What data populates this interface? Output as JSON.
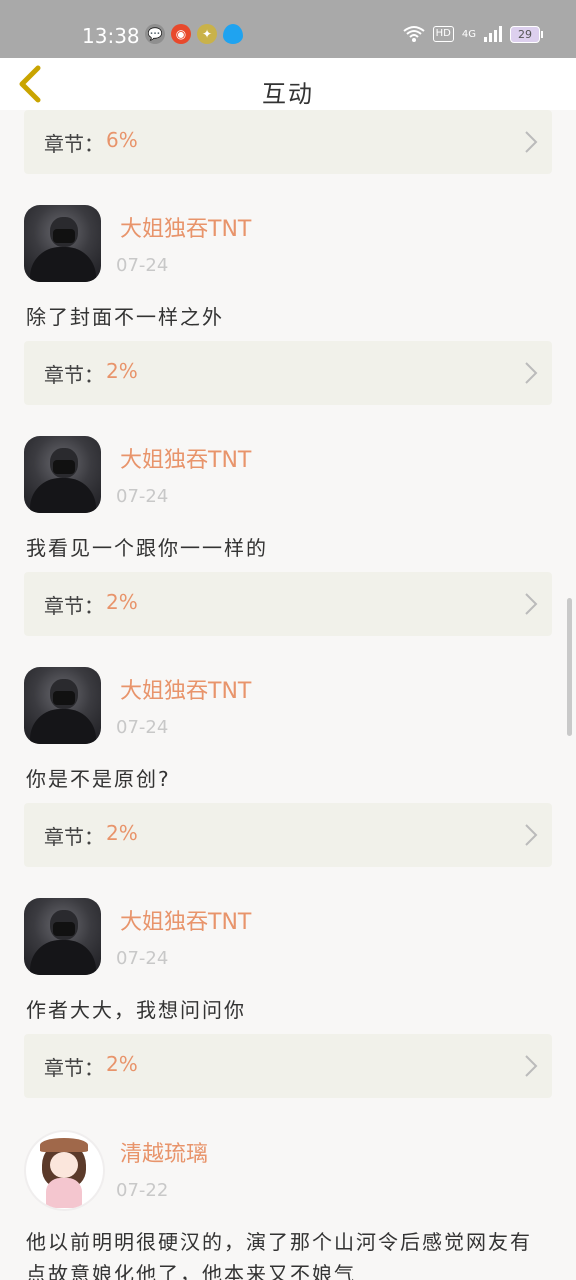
{
  "status": {
    "time": "13:38",
    "network": "4G",
    "hd": "HD",
    "battery": "29",
    "left_icons": [
      "wechat-icon",
      "weibo-icon",
      "bulb-icon",
      "drop-icon"
    ]
  },
  "header": {
    "title": "互动"
  },
  "chapter_label": "章节：",
  "top_chapter": {
    "value": "6%"
  },
  "comments": [
    {
      "user": "大姐独吞TNT",
      "date": "07-24",
      "text": "除了封面不一样之外",
      "chapter": "2%"
    },
    {
      "user": "大姐独吞TNT",
      "date": "07-24",
      "text": "我看见一个跟你一一样的",
      "chapter": "2%"
    },
    {
      "user": "大姐独吞TNT",
      "date": "07-24",
      "text": "你是不是原创?",
      "chapter": "2%"
    },
    {
      "user": "大姐独吞TNT",
      "date": "07-24",
      "text": "作者大大，我想问问你",
      "chapter": "2%"
    },
    {
      "user": "清越琉璃",
      "date": "07-22",
      "text": "他以前明明很硬汉的，演了那个山河令后感觉网友有点故意娘化他了，他本来又不娘气"
    }
  ],
  "colors": {
    "accent": "#e8946b",
    "chapter_bg": "#f1f1ea",
    "back_arrow": "#c9a400"
  }
}
